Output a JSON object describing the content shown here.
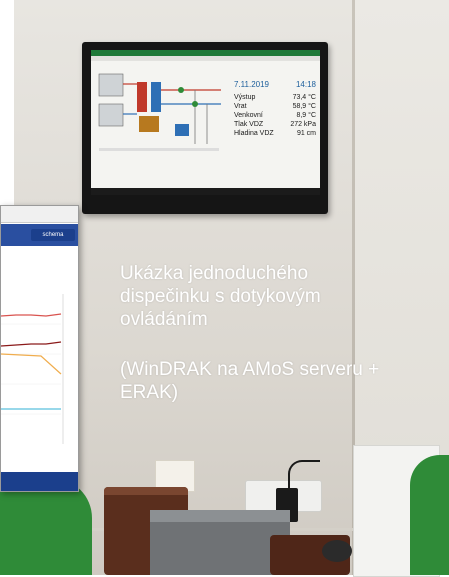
{
  "caption": {
    "line1": "Ukázka jednoduchého dispečinku s dotykovým ovládáním",
    "line2": "(WinDRAK na AMoS serveru + ERAK)"
  },
  "tv_display": {
    "date": "7.11.2019",
    "time": "14:18",
    "readings": [
      {
        "label": "Výstup",
        "value": "73,4 °C"
      },
      {
        "label": "Vrat",
        "value": "58,9 °C"
      },
      {
        "label": "Venkovní",
        "value": "8,9 °C"
      },
      {
        "label": "Tlak VDZ",
        "value": "272 kPa"
      },
      {
        "label": "Hladina VDZ",
        "value": "91 cm"
      }
    ]
  },
  "inset": {
    "tab_label": "schema"
  },
  "colors": {
    "accent_green": "#2f8b38",
    "screen_header": "#1f7a3a",
    "inset_blue": "#1b3f8c"
  }
}
